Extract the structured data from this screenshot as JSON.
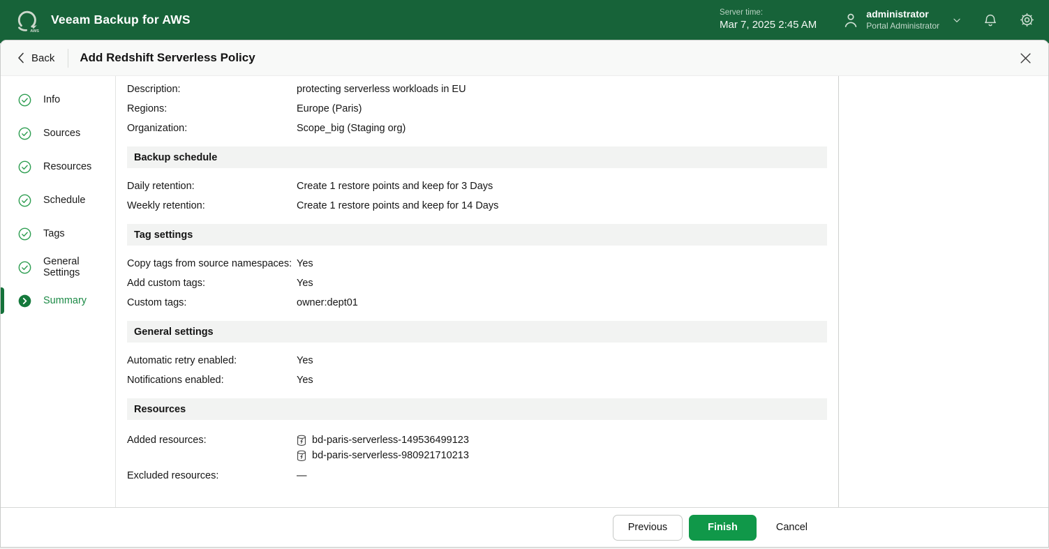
{
  "header": {
    "app_title": "Veeam Backup for AWS",
    "server_time_label": "Server time:",
    "server_time_value": "Mar 7, 2025 2:45 AM",
    "user_name": "administrator",
    "user_role": "Portal Administrator"
  },
  "toolbar": {
    "back_label": "Back",
    "title": "Add Redshift Serverless Policy"
  },
  "sidebar": {
    "steps": [
      {
        "label": "Info",
        "state": "complete"
      },
      {
        "label": "Sources",
        "state": "complete"
      },
      {
        "label": "Resources",
        "state": "complete"
      },
      {
        "label": "Schedule",
        "state": "complete"
      },
      {
        "label": "Tags",
        "state": "complete"
      },
      {
        "label": "General Settings",
        "state": "complete"
      },
      {
        "label": "Summary",
        "state": "active"
      }
    ]
  },
  "summary": {
    "info_rows": [
      {
        "label": "Description:",
        "value": "protecting serverless workloads in EU"
      },
      {
        "label": "Regions:",
        "value": "Europe (Paris)"
      },
      {
        "label": "Organization:",
        "value": "Scope_big (Staging org)"
      }
    ],
    "sections": [
      {
        "title": "Backup schedule",
        "rows": [
          {
            "label": "Daily retention:",
            "value": "Create 1 restore points and keep for 3 Days"
          },
          {
            "label": "Weekly retention:",
            "value": "Create 1 restore points and keep for 14 Days"
          }
        ]
      },
      {
        "title": "Tag settings",
        "rows": [
          {
            "label": "Copy tags from source namespaces:",
            "value": "Yes"
          },
          {
            "label": "Add custom tags:",
            "value": "Yes"
          },
          {
            "label": "Custom tags:",
            "value": "owner:dept01"
          }
        ]
      },
      {
        "title": "General settings",
        "rows": [
          {
            "label": "Automatic retry enabled:",
            "value": "Yes"
          },
          {
            "label": "Notifications enabled:",
            "value": "Yes"
          }
        ]
      }
    ],
    "resources": {
      "title": "Resources",
      "added_label": "Added resources:",
      "added_items": [
        "bd-paris-serverless-149536499123",
        "bd-paris-serverless-980921710213"
      ],
      "excluded_label": "Excluded resources:",
      "excluded_value": "—"
    }
  },
  "footer": {
    "previous_label": "Previous",
    "finish_label": "Finish",
    "cancel_label": "Cancel"
  },
  "icons": {
    "brand": "veeam-aws-circular-arrow-logo",
    "user": "person-outline",
    "expand": "chevron-down",
    "notifications": "bell-outline",
    "settings": "gear-outline",
    "back": "chevron-left",
    "close": "x-close",
    "step_complete": "check-circle",
    "step_active": "arrow-circle",
    "resource": "redshift-serverless-database"
  },
  "colors": {
    "header_green": "#176339",
    "check_green": "#2f9e52",
    "active_step_green": "#1c8a46",
    "finish_button_green": "#109849",
    "section_band_gray": "#f2f3f2"
  }
}
